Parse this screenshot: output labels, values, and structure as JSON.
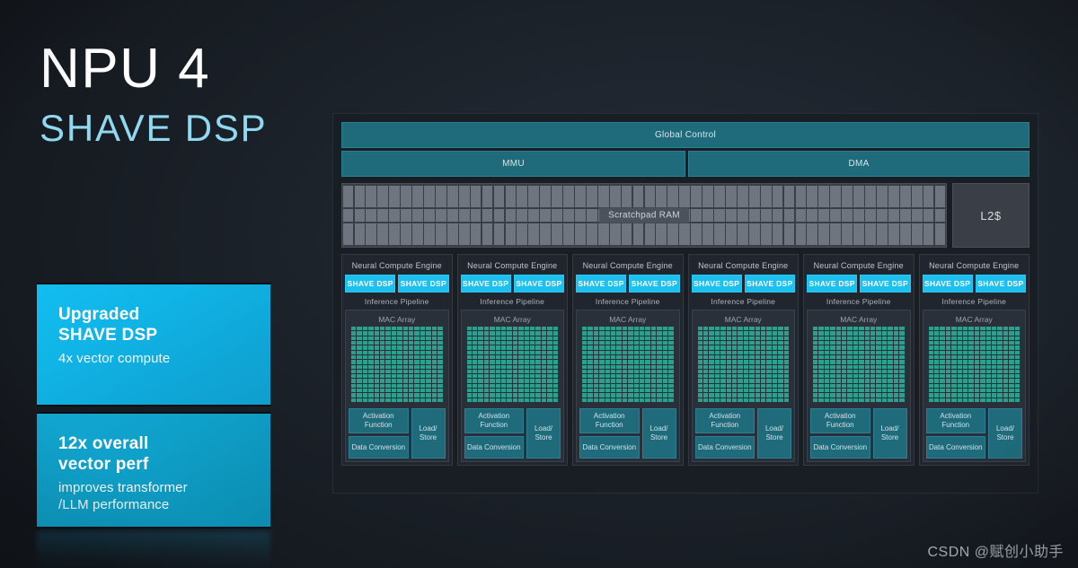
{
  "slide": {
    "title_main": "NPU 4",
    "title_sub": "SHAVE DSP"
  },
  "callouts": [
    {
      "head_line1": "Upgraded",
      "head_line2": "SHAVE DSP",
      "sub": "4x vector compute",
      "color": "#11b6e8"
    },
    {
      "head_line1": "12x overall",
      "head_line2": "vector perf",
      "sub_line1": "improves transformer",
      "sub_line2": "/LLM performance",
      "color": "#0fa0c9"
    }
  ],
  "diagram": {
    "global_control": "Global Control",
    "mmu": "MMU",
    "dma": "DMA",
    "scratchpad": "Scratchpad RAM",
    "l2_cache": "L2$",
    "scratchpad_columns": 52,
    "nce_count": 6,
    "nce": {
      "title": "Neural Compute Engine",
      "shave_dsp": "SHAVE DSP",
      "shave_count": 2,
      "inference_pipeline": "Inference Pipeline",
      "mac_array": "MAC Array",
      "mac_rows": 16,
      "mac_cols": 16,
      "activation_function_line1": "Activation",
      "activation_function_line2": "Function",
      "data_conversion": "Data Conversion",
      "load_store_line1": "Load/",
      "load_store_line2": "Store"
    },
    "colors": {
      "teal_block": "#1f6b7c",
      "shave_highlight": "#1ec0f0",
      "mac_cell": "#2aa08f",
      "panel_bg": "#191d24",
      "memory_bg": "#3a3f47"
    }
  },
  "watermark": "CSDN @赋创小助手"
}
